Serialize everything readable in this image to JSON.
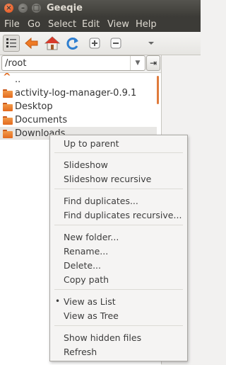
{
  "window": {
    "title": "Geeqie"
  },
  "menubar": [
    "File",
    "Go",
    "Select",
    "Edit",
    "View",
    "Help"
  ],
  "toolbar": {
    "icons": [
      "list-view-icon",
      "back-arrow-icon",
      "home-icon",
      "refresh-icon",
      "zoom-in-icon",
      "zoom-out-icon",
      "overflow-chevron-icon"
    ]
  },
  "path": {
    "value": "/root"
  },
  "files": [
    {
      "name": "..",
      "type": "parent"
    },
    {
      "name": "activity-log-manager-0.9.1",
      "type": "folder"
    },
    {
      "name": "Desktop",
      "type": "folder"
    },
    {
      "name": "Documents",
      "type": "folder"
    },
    {
      "name": "Downloads",
      "type": "folder",
      "selected": true
    }
  ],
  "context_menu": {
    "items": [
      "Up to parent",
      "Slideshow",
      "Slideshow recursive",
      "Find duplicates...",
      "Find duplicates recursive...",
      "New folder...",
      "Rename...",
      "Delete...",
      "Copy path",
      "View as List",
      "View as Tree",
      "Show hidden files",
      "Refresh"
    ],
    "checked": "View as List"
  },
  "colors": {
    "accent": "#e36a1e",
    "titlebar": "#3c3b37",
    "close": "#e1511a"
  }
}
